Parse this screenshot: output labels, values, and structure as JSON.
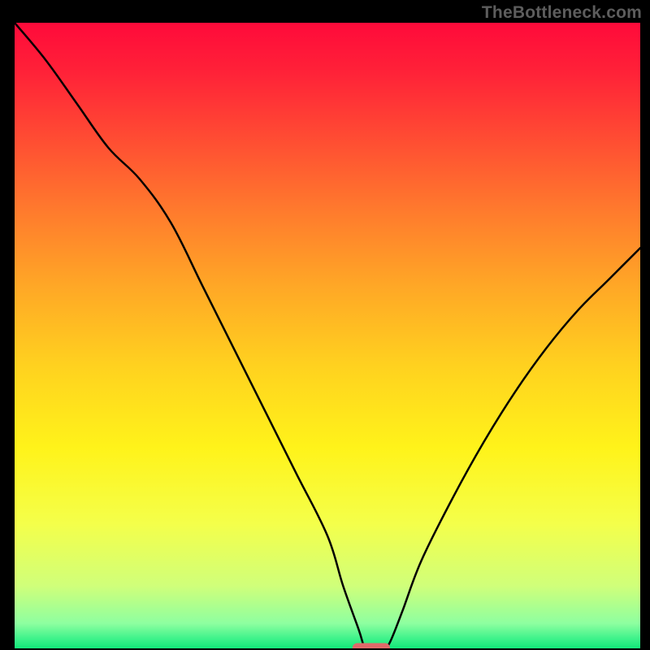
{
  "watermark": "TheBottleneck.com",
  "chart_data": {
    "type": "line",
    "title": "",
    "xlabel": "",
    "ylabel": "",
    "xlim": [
      0,
      100
    ],
    "ylim": [
      0,
      100
    ],
    "x": [
      0,
      5,
      10,
      15,
      20,
      25,
      30,
      35,
      40,
      45,
      50,
      52.5,
      55,
      56,
      57,
      58,
      59,
      60,
      62,
      65,
      70,
      75,
      80,
      85,
      90,
      95,
      100
    ],
    "y": [
      100,
      94,
      87,
      80,
      75,
      68,
      58,
      48,
      38,
      28,
      18,
      10,
      3,
      0,
      0,
      0,
      0,
      1,
      6,
      14,
      24,
      33,
      41,
      48,
      54,
      59,
      64
    ],
    "optimal_zone": {
      "x_start": 54,
      "x_end": 60,
      "y": 0
    },
    "gradient_stops": [
      {
        "offset": 0.0,
        "color": "#ff0a3a"
      },
      {
        "offset": 0.08,
        "color": "#ff2238"
      },
      {
        "offset": 0.18,
        "color": "#ff4a33"
      },
      {
        "offset": 0.3,
        "color": "#ff7a2d"
      },
      {
        "offset": 0.42,
        "color": "#ffa726"
      },
      {
        "offset": 0.55,
        "color": "#ffd21f"
      },
      {
        "offset": 0.68,
        "color": "#fff31a"
      },
      {
        "offset": 0.8,
        "color": "#f4ff4a"
      },
      {
        "offset": 0.9,
        "color": "#d0ff7a"
      },
      {
        "offset": 0.96,
        "color": "#8effa0"
      },
      {
        "offset": 0.985,
        "color": "#3cf28a"
      },
      {
        "offset": 1.0,
        "color": "#12e879"
      }
    ]
  }
}
